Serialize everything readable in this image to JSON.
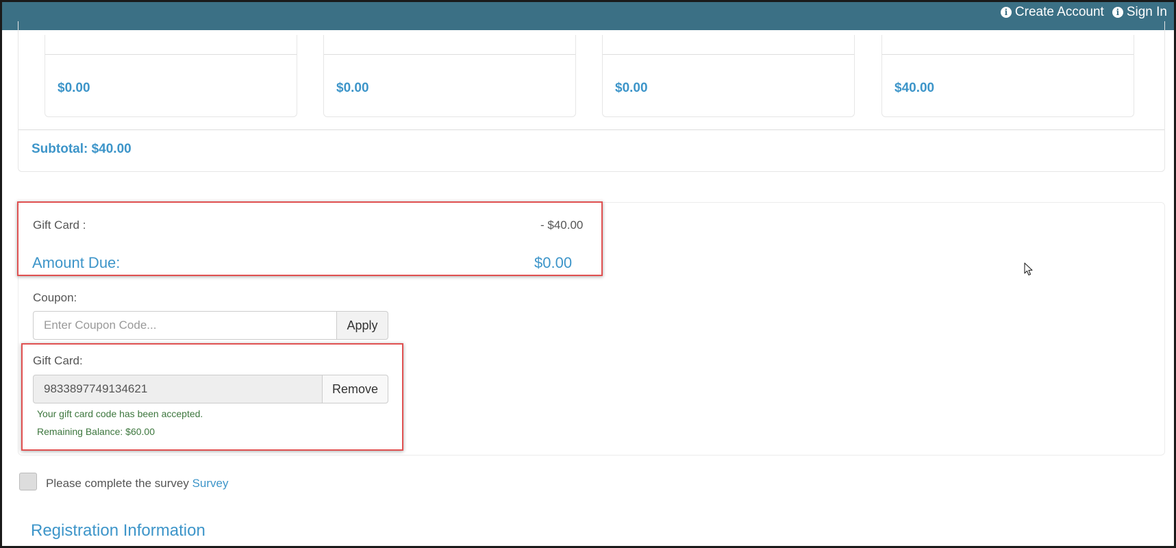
{
  "header": {
    "create_account": "Create Account",
    "sign_in": "Sign In"
  },
  "cart": {
    "items": [
      {
        "price": "$0.00"
      },
      {
        "price": "$0.00"
      },
      {
        "price": "$0.00"
      },
      {
        "price": "$40.00"
      }
    ],
    "subtotal": "Subtotal: $40.00"
  },
  "payment": {
    "gift_card_label": "Gift Card :",
    "gift_card_amount": "- $40.00",
    "amount_due_label": "Amount Due:",
    "amount_due_value": "$0.00",
    "coupon": {
      "label": "Coupon:",
      "placeholder": "Enter Coupon Code...",
      "value": "",
      "apply_label": "Apply"
    },
    "gift_card": {
      "label": "Gift Card:",
      "code": "9833897749134621",
      "remove_label": "Remove",
      "accepted_message": "Your gift card code has been accepted.",
      "remaining_balance": "Remaining Balance: $60.00"
    }
  },
  "survey": {
    "text": "Please complete the survey",
    "link": "Survey",
    "checked": false
  },
  "registration": {
    "title": "Registration Information"
  },
  "colors": {
    "header_bg": "#3b7085",
    "accent": "#3d95c9",
    "success": "#3c763d",
    "highlight": "#e05050"
  },
  "icons": {
    "nav": "info-circle-icon",
    "pointer": "mouse-cursor-icon"
  }
}
